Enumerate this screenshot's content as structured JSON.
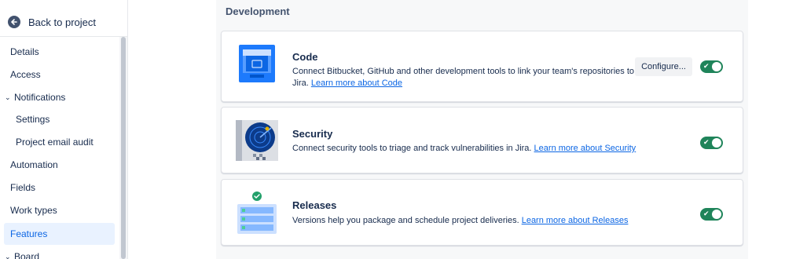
{
  "sidebar": {
    "back_label": "Back to project",
    "items": [
      {
        "label": "Details"
      },
      {
        "label": "Access"
      },
      {
        "label": "Notifications"
      },
      {
        "label": "Settings"
      },
      {
        "label": "Project email audit"
      },
      {
        "label": "Automation"
      },
      {
        "label": "Fields"
      },
      {
        "label": "Work types"
      },
      {
        "label": "Features",
        "active": true
      },
      {
        "label": "Board"
      }
    ]
  },
  "main": {
    "section_title": "Development",
    "features": [
      {
        "title": "Code",
        "description": "Connect Bitbucket, GitHub and other development tools to link your team's repositories to Jira.",
        "link": "Learn more about Code",
        "configure_label": "Configure...",
        "enabled": true,
        "icon": "code-repo-icon"
      },
      {
        "title": "Security",
        "description": "Connect security tools to triage and track vulnerabilities in Jira.",
        "link": "Learn more about Security",
        "enabled": true,
        "icon": "security-radar-icon"
      },
      {
        "title": "Releases",
        "description": "Versions help you package and schedule project deliveries.",
        "link": "Learn more about Releases",
        "enabled": true,
        "icon": "releases-list-icon"
      }
    ]
  },
  "colors": {
    "toggle_on": "#1f845a",
    "link": "#0c66e4",
    "active_nav_bg": "#e9f2ff"
  }
}
